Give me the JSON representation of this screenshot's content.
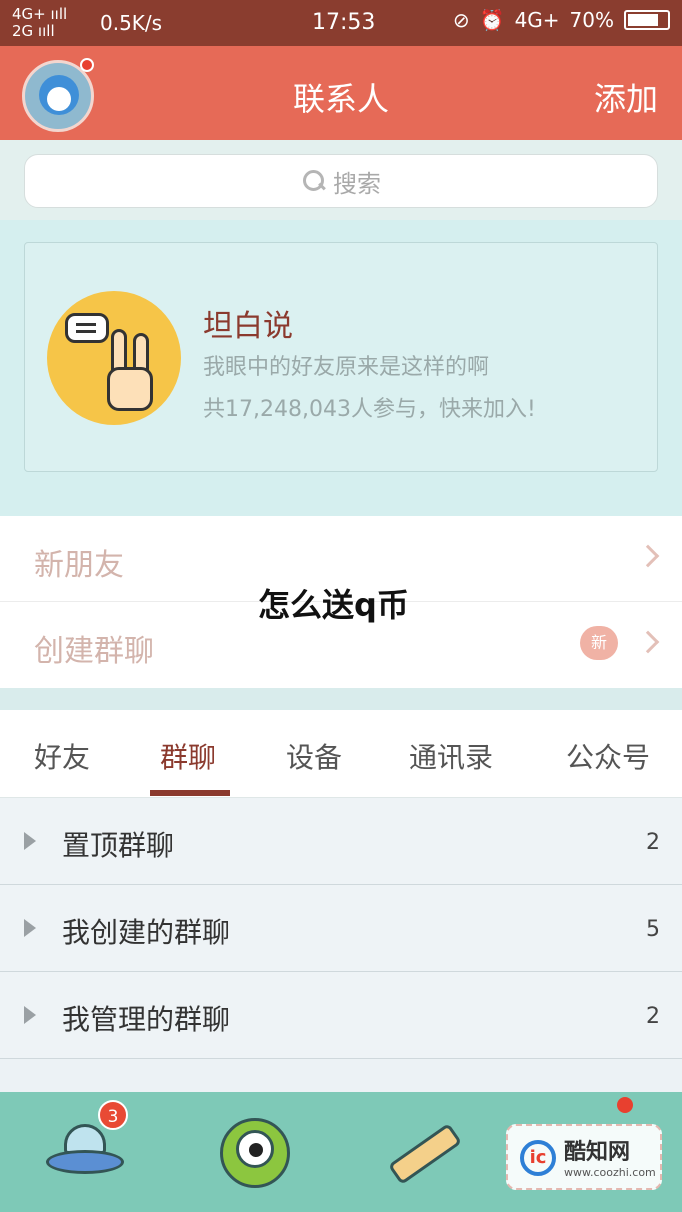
{
  "status_bar": {
    "network_top": "4G+ ııll",
    "network_bottom": "2G ııll",
    "speed": "0.5K/s",
    "time": "17:53",
    "right_network": "4G+",
    "battery": "70%"
  },
  "header": {
    "title": "联系人",
    "add_label": "添加"
  },
  "search": {
    "placeholder": "搜索"
  },
  "promo": {
    "title": "坦白说",
    "line1": "我眼中的好友原来是这样的啊",
    "line2": "共17,248,043人参与，快来加入!"
  },
  "entries": {
    "new_friends": "新朋友",
    "create_group": "创建群聊",
    "new_badge": "新"
  },
  "overlay_caption": "怎么送q币",
  "tabs": [
    {
      "label": "好友"
    },
    {
      "label": "群聊"
    },
    {
      "label": "设备"
    },
    {
      "label": "通讯录"
    },
    {
      "label": "公众号"
    }
  ],
  "active_tab": "群聊",
  "groups": [
    {
      "label": "置顶群聊",
      "count": "2"
    },
    {
      "label": "我创建的群聊",
      "count": "5"
    },
    {
      "label": "我管理的群聊",
      "count": "2"
    }
  ],
  "bottom_nav": {
    "badge_count": "3"
  },
  "watermark": {
    "logo": "ic",
    "title": "酷知网",
    "url": "www.coozhi.com"
  },
  "colors": {
    "header_bg": "#e66a57",
    "status_bg": "#8a3d2f",
    "accent": "#8b3a2e",
    "bottom_nav_bg": "#7ec9b7"
  }
}
